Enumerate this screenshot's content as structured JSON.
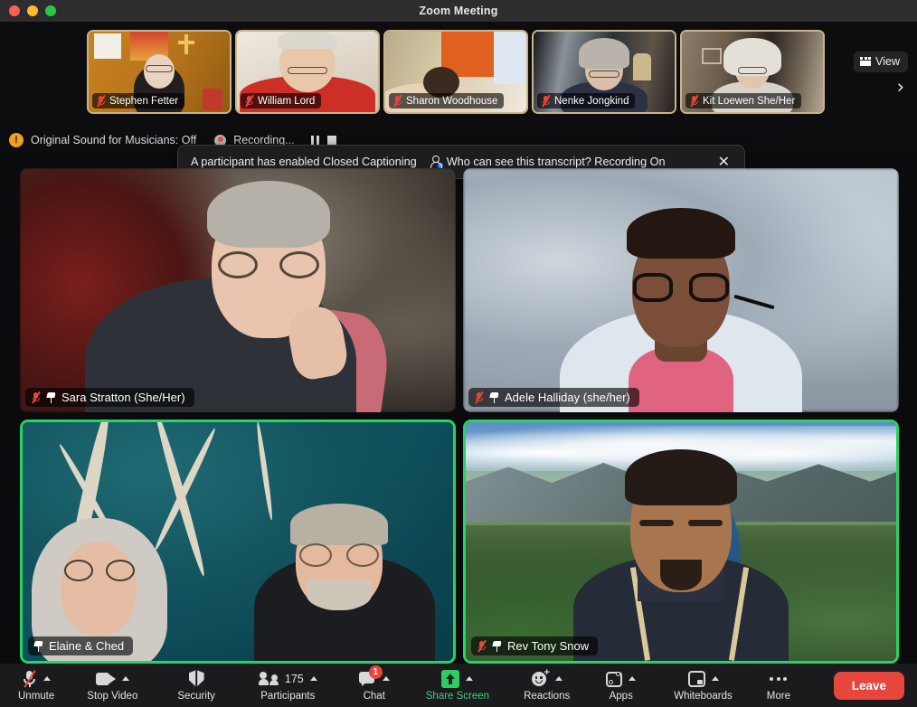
{
  "window": {
    "title": "Zoom Meeting",
    "traffic_lights": [
      "close-red",
      "minimize-yellow",
      "maximize-green"
    ]
  },
  "filmstrip": {
    "view_button": {
      "label": "View",
      "icon": "grid-view-icon"
    },
    "next_arrow": "›",
    "thumbnails": [
      {
        "name": "Stephen Fetter",
        "muted": true
      },
      {
        "name": "William Lord",
        "muted": true
      },
      {
        "name": "Sharon Woodhouse",
        "muted": true
      },
      {
        "name": "Nenke Jongkind",
        "muted": true
      },
      {
        "name": "Kit  Loewen She/Her",
        "muted": true
      }
    ]
  },
  "status_bar": {
    "warning_icon": "warning-icon",
    "original_sound": "Original Sound for Musicians: Off",
    "recording_label": "Recording...",
    "pause_icon": "pause-recording-icon",
    "stop_icon": "stop-recording-icon"
  },
  "toast": {
    "message": "A participant has enabled Closed Captioning",
    "link_text": "Who can see this transcript? Recording On",
    "link_icon": "person-transcript-icon",
    "close_label": "✕"
  },
  "gallery": {
    "tiles": [
      {
        "name": "Sara Stratton (She/Her)",
        "muted": true,
        "pinned": true,
        "speaking": false
      },
      {
        "name": "Adele Halliday (she/her)",
        "muted": true,
        "pinned": true,
        "speaking": false
      },
      {
        "name": "Elaine & Ched",
        "muted": false,
        "pinned": true,
        "speaking": true
      },
      {
        "name": "Rev Tony Snow",
        "muted": true,
        "pinned": true,
        "speaking": true
      }
    ]
  },
  "toolbar": {
    "audio": {
      "label": "Unmute",
      "icon": "microphone-muted-icon"
    },
    "video": {
      "label": "Stop Video",
      "icon": "camera-icon"
    },
    "security": {
      "label": "Security",
      "icon": "shield-icon"
    },
    "participants": {
      "label": "Participants",
      "icon": "people-icon",
      "count": "175"
    },
    "chat": {
      "label": "Chat",
      "icon": "chat-bubble-icon",
      "badge": "1"
    },
    "share": {
      "label": "Share Screen",
      "icon": "share-screen-icon"
    },
    "reactions": {
      "label": "Reactions",
      "icon": "reactions-icon"
    },
    "apps": {
      "label": "Apps",
      "icon": "apps-icon"
    },
    "whiteboards": {
      "label": "Whiteboards",
      "icon": "whiteboard-icon"
    },
    "more": {
      "label": "More",
      "icon": "ellipsis-icon"
    },
    "leave": {
      "label": "Leave"
    }
  },
  "colors": {
    "accent_green": "#25d366",
    "danger_red": "#e8453c",
    "share_green": "#2ecc63",
    "thumb_border": "#c9b48a",
    "window_chrome": "#2d2d2f"
  }
}
